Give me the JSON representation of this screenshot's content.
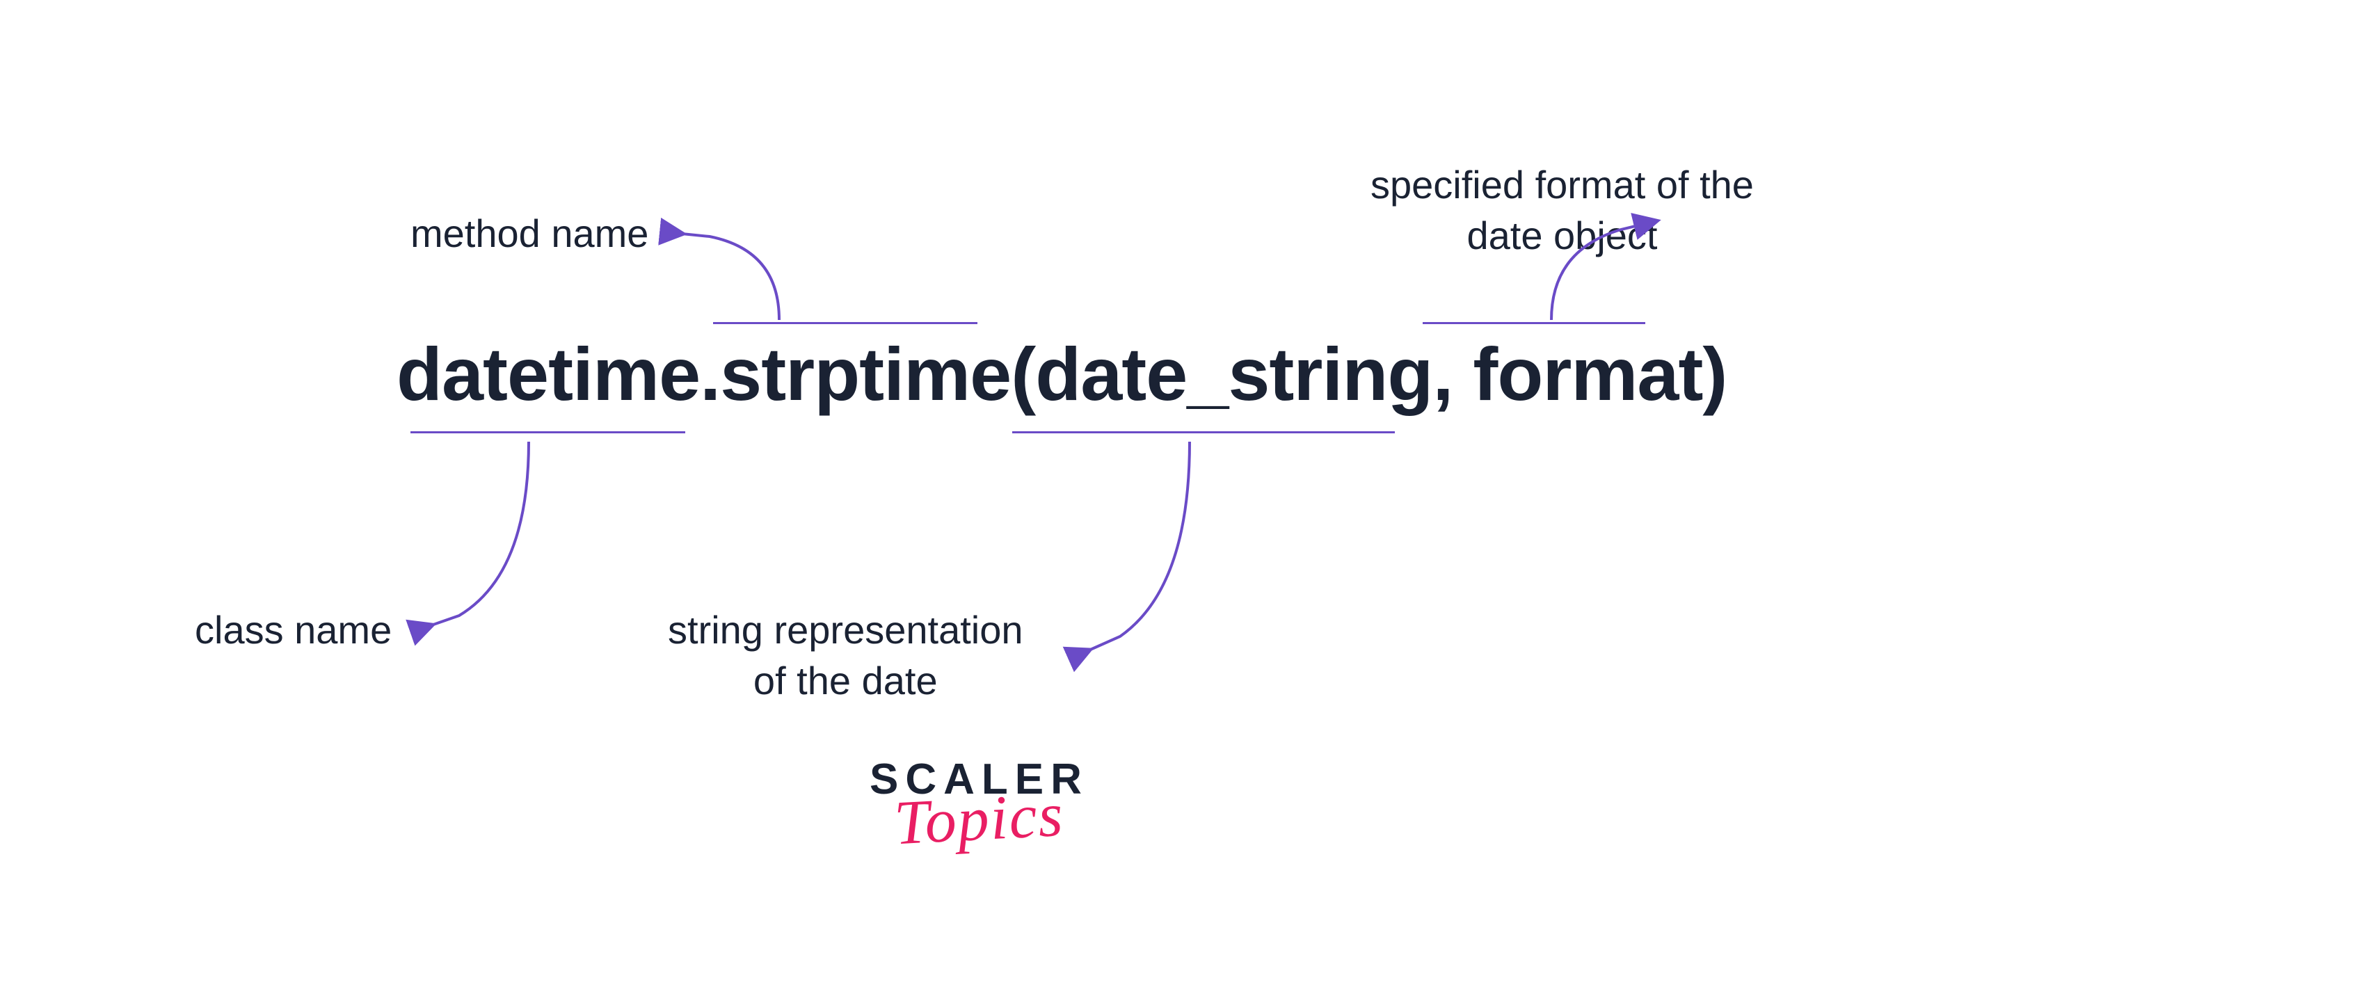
{
  "expression": {
    "class_name": "datetime",
    "dot": ".",
    "method_name": "strptime",
    "open_paren": "(",
    "arg1": "date_string",
    "comma": ",",
    "space": " ",
    "arg2": "format",
    "close_paren": ")"
  },
  "annotations": {
    "method_name_label": "method name",
    "class_name_label": "class name",
    "string_rep_label_line1": "string representation",
    "string_rep_label_line2": "of the date",
    "format_spec_label_line1": "specified format of the",
    "format_spec_label_line2": "date object"
  },
  "logo": {
    "brand": "SCALER",
    "subbrand": "Topics"
  },
  "colors": {
    "text_dark": "#1a2233",
    "accent_purple": "#6a4bc7",
    "accent_pink": "#e91e63"
  }
}
